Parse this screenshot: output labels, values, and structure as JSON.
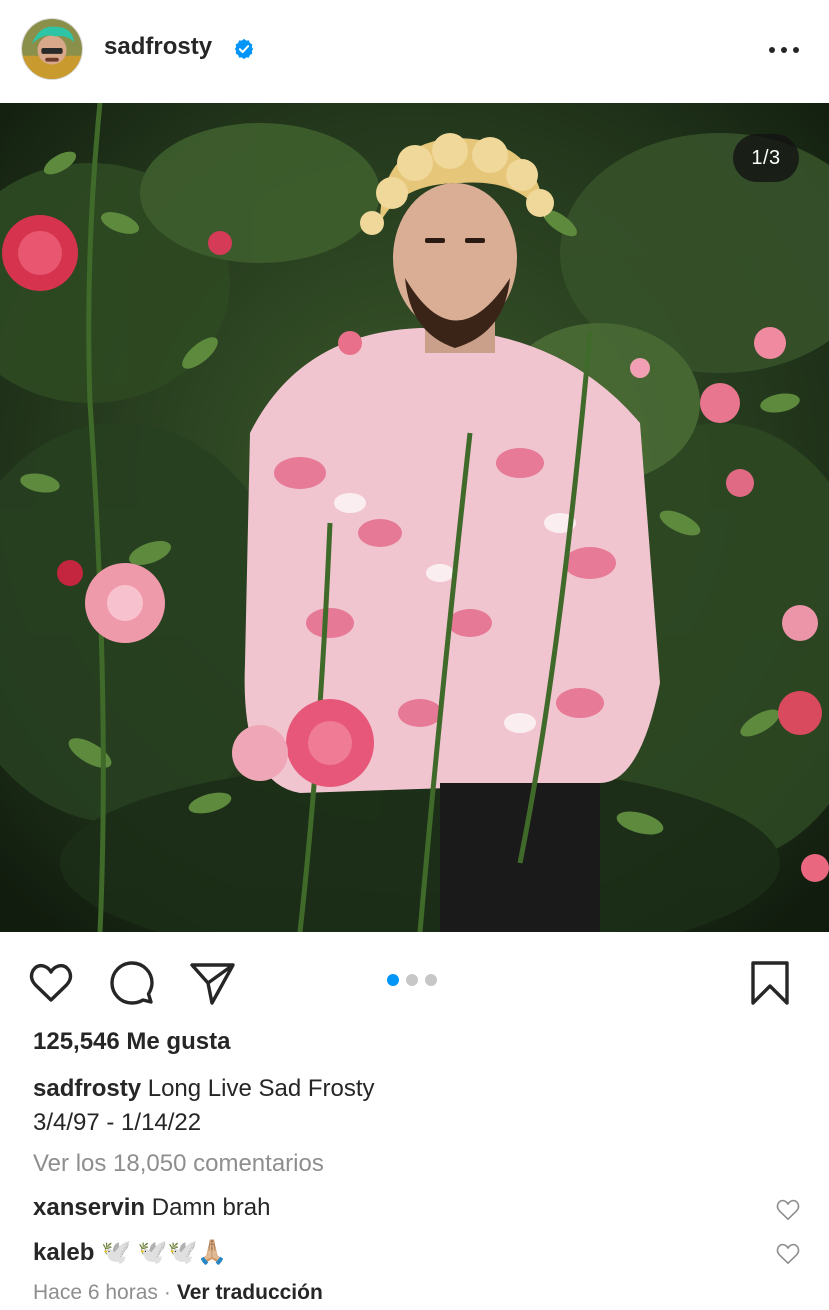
{
  "post": {
    "username": "sadfrosty",
    "verified": true,
    "image_counter": "1/3",
    "carousel_dots": 3,
    "carousel_active": 0,
    "likes": "125,546 Me gusta",
    "caption_user": "sadfrosty",
    "caption_text": "Long Live Sad Frosty",
    "caption_line2": "3/4/97 - 1/14/22",
    "view_comments": "Ver los 18,050 comentarios",
    "comments": [
      {
        "user": "xanservin",
        "text": "Damn brah"
      },
      {
        "user": "kaleb",
        "text": "🕊️ 🕊️🕊️🙏🏼"
      }
    ],
    "time_ago": "Hace 6 horas",
    "separator": "·",
    "translate": "Ver traducción"
  },
  "icons": {
    "more": "more-options-icon",
    "like": "heart-icon",
    "comment": "comment-icon",
    "share": "send-icon",
    "save": "bookmark-icon",
    "verified": "verified-badge-icon"
  },
  "colors": {
    "accent": "#0095f6",
    "verified": "#0095f6",
    "muted": "#8e8e8e",
    "text": "#262626"
  }
}
